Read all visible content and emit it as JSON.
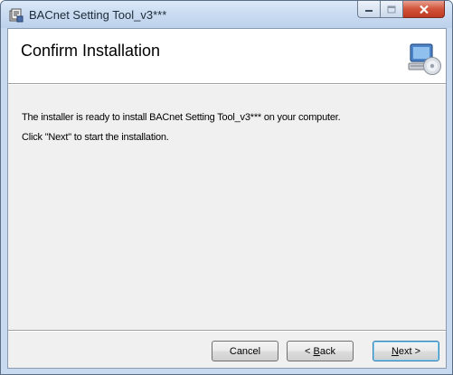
{
  "window": {
    "title": "BACnet Setting Tool_v3***"
  },
  "banner": {
    "heading": "Confirm Installation",
    "icon": "setup-computer-disc-icon"
  },
  "content": {
    "line1": "The installer is ready to install BACnet Setting Tool_v3*** on your computer.",
    "line2": "Click \"Next\" to start the installation."
  },
  "buttons": {
    "cancel": "Cancel",
    "back_prefix": "< ",
    "back_key": "B",
    "back_rest": "ack",
    "next_key": "N",
    "next_rest": "ext >"
  },
  "caption": {
    "minimize": "minimize-icon",
    "maximize": "maximize-icon",
    "close": "close-icon"
  }
}
